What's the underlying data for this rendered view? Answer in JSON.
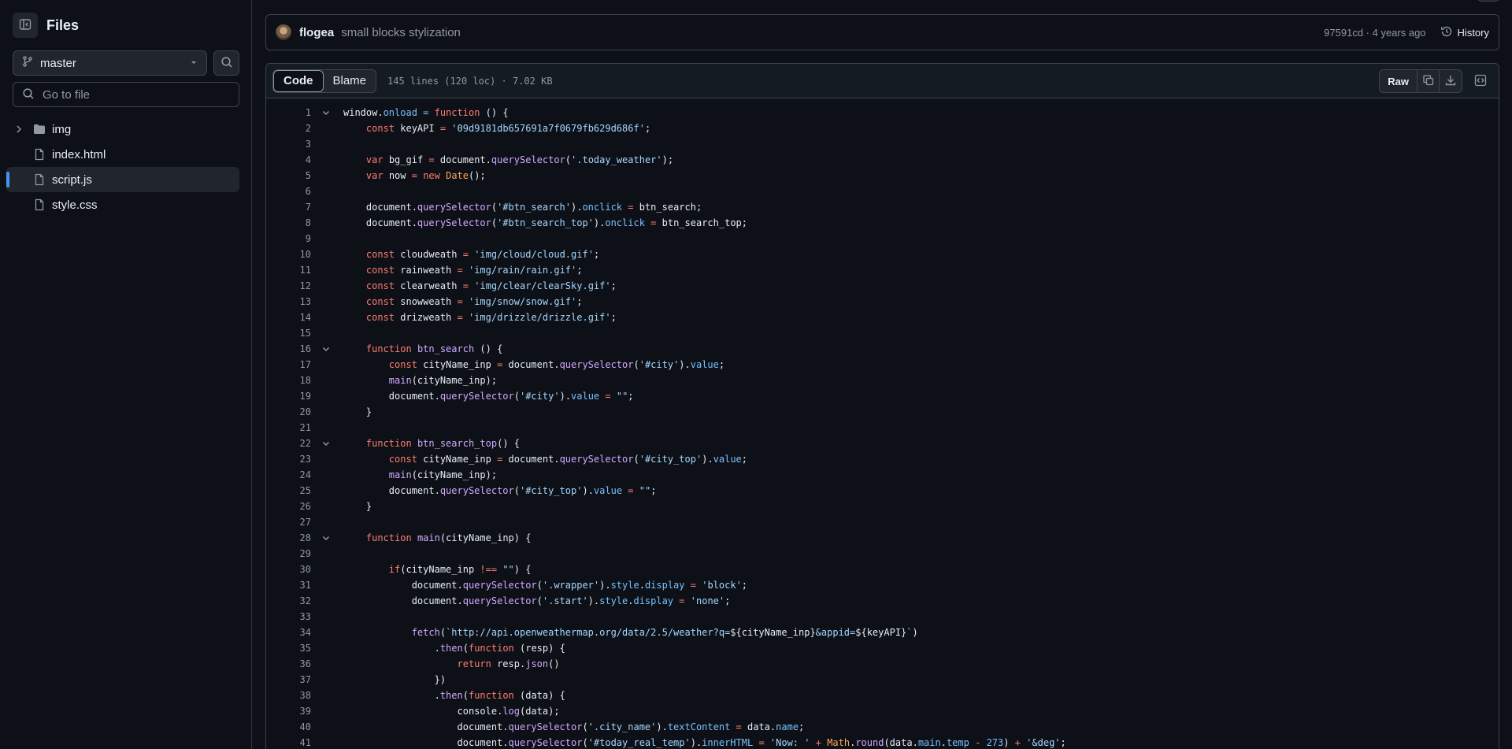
{
  "sidebar": {
    "title": "Files",
    "branch": "master",
    "goto_placeholder": "Go to file",
    "tree": [
      {
        "name": "img",
        "type": "folder",
        "active": false
      },
      {
        "name": "index.html",
        "type": "file",
        "active": false
      },
      {
        "name": "script.js",
        "type": "file",
        "active": true
      },
      {
        "name": "style.css",
        "type": "file",
        "active": false
      }
    ]
  },
  "commit": {
    "author": "flogea",
    "message": "small blocks stylization",
    "meta": "97591cd · 4 years ago",
    "history_label": "History"
  },
  "file": {
    "tabs": [
      {
        "label": "Code",
        "selected": true
      },
      {
        "label": "Blame",
        "selected": false
      }
    ],
    "info": "145 lines (120 loc) · 7.02 KB",
    "raw_label": "Raw"
  },
  "colors": {
    "keyword": "#ff7b72",
    "string": "#a5d6ff",
    "function": "#d2a8ff",
    "property": "#79c0ff",
    "builtin": "#ffa657",
    "accent": "#4493f8"
  },
  "code": [
    {
      "n": "1",
      "fold": true,
      "t": [
        [
          "",
          "window."
        ],
        [
          "p",
          "onload"
        ],
        [
          "p",
          " = "
        ],
        [
          "k",
          "function"
        ],
        [
          "",
          " () {"
        ]
      ]
    },
    {
      "n": "2",
      "t": [
        [
          "",
          "    "
        ],
        [
          "k",
          "const"
        ],
        [
          "",
          " keyAPI "
        ],
        [
          "k",
          "="
        ],
        [
          "",
          " "
        ],
        [
          "s",
          "'09d9181db657691a7f0679fb629d686f'"
        ],
        [
          "",
          ";"
        ]
      ]
    },
    {
      "n": "3",
      "t": [
        [
          "",
          ""
        ]
      ]
    },
    {
      "n": "4",
      "t": [
        [
          "",
          "    "
        ],
        [
          "k",
          "var"
        ],
        [
          "",
          " bg_gif "
        ],
        [
          "k",
          "="
        ],
        [
          "",
          " document."
        ],
        [
          "f",
          "querySelector"
        ],
        [
          "",
          "("
        ],
        [
          "s",
          "'.today_weather'"
        ],
        [
          "",
          ");"
        ]
      ]
    },
    {
      "n": "5",
      "t": [
        [
          "",
          "    "
        ],
        [
          "k",
          "var"
        ],
        [
          "",
          " now "
        ],
        [
          "k",
          "="
        ],
        [
          "",
          " "
        ],
        [
          "k",
          "new"
        ],
        [
          "",
          " "
        ],
        [
          "o",
          "Date"
        ],
        [
          "",
          "();"
        ]
      ]
    },
    {
      "n": "6",
      "t": [
        [
          "",
          ""
        ]
      ]
    },
    {
      "n": "7",
      "t": [
        [
          "",
          "    document."
        ],
        [
          "f",
          "querySelector"
        ],
        [
          "",
          "("
        ],
        [
          "s",
          "'#btn_search'"
        ],
        [
          "",
          ")."
        ],
        [
          "p",
          "onclick"
        ],
        [
          "",
          " "
        ],
        [
          "k",
          "="
        ],
        [
          "",
          " btn_search;"
        ]
      ]
    },
    {
      "n": "8",
      "t": [
        [
          "",
          "    document."
        ],
        [
          "f",
          "querySelector"
        ],
        [
          "",
          "("
        ],
        [
          "s",
          "'#btn_search_top'"
        ],
        [
          "",
          ")."
        ],
        [
          "p",
          "onclick"
        ],
        [
          "",
          " "
        ],
        [
          "k",
          "="
        ],
        [
          "",
          " btn_search_top;"
        ]
      ]
    },
    {
      "n": "9",
      "t": [
        [
          "",
          ""
        ]
      ]
    },
    {
      "n": "10",
      "t": [
        [
          "",
          "    "
        ],
        [
          "k",
          "const"
        ],
        [
          "",
          " cloudweath "
        ],
        [
          "k",
          "="
        ],
        [
          "",
          " "
        ],
        [
          "s",
          "'img/cloud/cloud.gif'"
        ],
        [
          "",
          ";"
        ]
      ]
    },
    {
      "n": "11",
      "t": [
        [
          "",
          "    "
        ],
        [
          "k",
          "const"
        ],
        [
          "",
          " rainweath "
        ],
        [
          "k",
          "="
        ],
        [
          "",
          " "
        ],
        [
          "s",
          "'img/rain/rain.gif'"
        ],
        [
          "",
          ";"
        ]
      ]
    },
    {
      "n": "12",
      "t": [
        [
          "",
          "    "
        ],
        [
          "k",
          "const"
        ],
        [
          "",
          " clearweath "
        ],
        [
          "k",
          "="
        ],
        [
          "",
          " "
        ],
        [
          "s",
          "'img/clear/clearSky.gif'"
        ],
        [
          "",
          ";"
        ]
      ]
    },
    {
      "n": "13",
      "t": [
        [
          "",
          "    "
        ],
        [
          "k",
          "const"
        ],
        [
          "",
          " snowweath "
        ],
        [
          "k",
          "="
        ],
        [
          "",
          " "
        ],
        [
          "s",
          "'img/snow/snow.gif'"
        ],
        [
          "",
          ";"
        ]
      ]
    },
    {
      "n": "14",
      "t": [
        [
          "",
          "    "
        ],
        [
          "k",
          "const"
        ],
        [
          "",
          " drizweath "
        ],
        [
          "k",
          "="
        ],
        [
          "",
          " "
        ],
        [
          "s",
          "'img/drizzle/drizzle.gif'"
        ],
        [
          "",
          ";"
        ]
      ]
    },
    {
      "n": "15",
      "t": [
        [
          "",
          ""
        ]
      ]
    },
    {
      "n": "16",
      "fold": true,
      "t": [
        [
          "",
          "    "
        ],
        [
          "k",
          "function"
        ],
        [
          "",
          " "
        ],
        [
          "f",
          "btn_search"
        ],
        [
          "",
          " () {"
        ]
      ]
    },
    {
      "n": "17",
      "t": [
        [
          "",
          "        "
        ],
        [
          "k",
          "const"
        ],
        [
          "",
          " cityName_inp "
        ],
        [
          "k",
          "="
        ],
        [
          "",
          " document."
        ],
        [
          "f",
          "querySelector"
        ],
        [
          "",
          "("
        ],
        [
          "s",
          "'#city'"
        ],
        [
          "",
          ")."
        ],
        [
          "p",
          "value"
        ],
        [
          "",
          ";"
        ]
      ]
    },
    {
      "n": "18",
      "t": [
        [
          "",
          "        "
        ],
        [
          "f",
          "main"
        ],
        [
          "",
          "(cityName_inp);"
        ]
      ]
    },
    {
      "n": "19",
      "t": [
        [
          "",
          "        document."
        ],
        [
          "f",
          "querySelector"
        ],
        [
          "",
          "("
        ],
        [
          "s",
          "'#city'"
        ],
        [
          "",
          ")."
        ],
        [
          "p",
          "value"
        ],
        [
          "",
          " "
        ],
        [
          "k",
          "="
        ],
        [
          "",
          " "
        ],
        [
          "s",
          "\"\""
        ],
        [
          "",
          ";"
        ]
      ]
    },
    {
      "n": "20",
      "t": [
        [
          "",
          "    }"
        ]
      ]
    },
    {
      "n": "21",
      "t": [
        [
          "",
          ""
        ]
      ]
    },
    {
      "n": "22",
      "fold": true,
      "t": [
        [
          "",
          "    "
        ],
        [
          "k",
          "function"
        ],
        [
          "",
          " "
        ],
        [
          "f",
          "btn_search_top"
        ],
        [
          "",
          "() {"
        ]
      ]
    },
    {
      "n": "23",
      "t": [
        [
          "",
          "        "
        ],
        [
          "k",
          "const"
        ],
        [
          "",
          " cityName_inp "
        ],
        [
          "k",
          "="
        ],
        [
          "",
          " document."
        ],
        [
          "f",
          "querySelector"
        ],
        [
          "",
          "("
        ],
        [
          "s",
          "'#city_top'"
        ],
        [
          "",
          ")."
        ],
        [
          "p",
          "value"
        ],
        [
          "",
          ";"
        ]
      ]
    },
    {
      "n": "24",
      "t": [
        [
          "",
          "        "
        ],
        [
          "f",
          "main"
        ],
        [
          "",
          "(cityName_inp);"
        ]
      ]
    },
    {
      "n": "25",
      "t": [
        [
          "",
          "        document."
        ],
        [
          "f",
          "querySelector"
        ],
        [
          "",
          "("
        ],
        [
          "s",
          "'#city_top'"
        ],
        [
          "",
          ")."
        ],
        [
          "p",
          "value"
        ],
        [
          "",
          " "
        ],
        [
          "k",
          "="
        ],
        [
          "",
          " "
        ],
        [
          "s",
          "\"\""
        ],
        [
          "",
          ";"
        ]
      ]
    },
    {
      "n": "26",
      "t": [
        [
          "",
          "    }"
        ]
      ]
    },
    {
      "n": "27",
      "t": [
        [
          "",
          ""
        ]
      ]
    },
    {
      "n": "28",
      "fold": true,
      "t": [
        [
          "",
          "    "
        ],
        [
          "k",
          "function"
        ],
        [
          "",
          " "
        ],
        [
          "f",
          "main"
        ],
        [
          "",
          "(cityName_inp) {"
        ]
      ]
    },
    {
      "n": "29",
      "t": [
        [
          "",
          ""
        ]
      ]
    },
    {
      "n": "30",
      "t": [
        [
          "",
          "        "
        ],
        [
          "k",
          "if"
        ],
        [
          "",
          "(cityName_inp "
        ],
        [
          "k",
          "!=="
        ],
        [
          "",
          " "
        ],
        [
          "s",
          "\"\""
        ],
        [
          "",
          ") {"
        ]
      ]
    },
    {
      "n": "31",
      "t": [
        [
          "",
          "            document."
        ],
        [
          "f",
          "querySelector"
        ],
        [
          "",
          "("
        ],
        [
          "s",
          "'.wrapper'"
        ],
        [
          "",
          ")."
        ],
        [
          "p",
          "style"
        ],
        [
          "",
          "."
        ],
        [
          "p",
          "display"
        ],
        [
          "",
          " "
        ],
        [
          "k",
          "="
        ],
        [
          "",
          " "
        ],
        [
          "s",
          "'block'"
        ],
        [
          "",
          ";"
        ]
      ]
    },
    {
      "n": "32",
      "t": [
        [
          "",
          "            document."
        ],
        [
          "f",
          "querySelector"
        ],
        [
          "",
          "("
        ],
        [
          "s",
          "'.start'"
        ],
        [
          "",
          ")."
        ],
        [
          "p",
          "style"
        ],
        [
          "",
          "."
        ],
        [
          "p",
          "display"
        ],
        [
          "",
          " "
        ],
        [
          "k",
          "="
        ],
        [
          "",
          " "
        ],
        [
          "s",
          "'none'"
        ],
        [
          "",
          ";"
        ]
      ]
    },
    {
      "n": "33",
      "t": [
        [
          "",
          ""
        ]
      ]
    },
    {
      "n": "34",
      "t": [
        [
          "",
          "            "
        ],
        [
          "f",
          "fetch"
        ],
        [
          "",
          "("
        ],
        [
          "s",
          "`http://api.openweathermap.org/data/2.5/weather?q="
        ],
        [
          "",
          "${cityName_inp}"
        ],
        [
          "s",
          "&appid="
        ],
        [
          "",
          "${keyAPI}"
        ],
        [
          "s",
          "`"
        ],
        [
          "",
          ")"
        ]
      ]
    },
    {
      "n": "35",
      "t": [
        [
          "",
          "                ."
        ],
        [
          "f",
          "then"
        ],
        [
          "",
          "("
        ],
        [
          "k",
          "function"
        ],
        [
          "",
          " (resp) {"
        ]
      ]
    },
    {
      "n": "36",
      "t": [
        [
          "",
          "                    "
        ],
        [
          "k",
          "return"
        ],
        [
          "",
          " resp."
        ],
        [
          "f",
          "json"
        ],
        [
          "",
          "()"
        ]
      ]
    },
    {
      "n": "37",
      "t": [
        [
          "",
          "                })"
        ]
      ]
    },
    {
      "n": "38",
      "t": [
        [
          "",
          "                ."
        ],
        [
          "f",
          "then"
        ],
        [
          "",
          "("
        ],
        [
          "k",
          "function"
        ],
        [
          "",
          " (data) {"
        ]
      ]
    },
    {
      "n": "39",
      "t": [
        [
          "",
          "                    console."
        ],
        [
          "f",
          "log"
        ],
        [
          "",
          "(data);"
        ]
      ]
    },
    {
      "n": "40",
      "t": [
        [
          "",
          "                    document."
        ],
        [
          "f",
          "querySelector"
        ],
        [
          "",
          "("
        ],
        [
          "s",
          "'.city_name'"
        ],
        [
          "",
          ")."
        ],
        [
          "p",
          "textContent"
        ],
        [
          "",
          " "
        ],
        [
          "k",
          "="
        ],
        [
          "",
          " data."
        ],
        [
          "p",
          "name"
        ],
        [
          "",
          ";"
        ]
      ]
    },
    {
      "n": "41",
      "t": [
        [
          "",
          "                    document."
        ],
        [
          "f",
          "querySelector"
        ],
        [
          "",
          "("
        ],
        [
          "s",
          "'#today_real_temp'"
        ],
        [
          "",
          ")."
        ],
        [
          "p",
          "innerHTML"
        ],
        [
          "",
          " "
        ],
        [
          "k",
          "="
        ],
        [
          "",
          " "
        ],
        [
          "s",
          "'Now: '"
        ],
        [
          "",
          " "
        ],
        [
          "k",
          "+"
        ],
        [
          "",
          " "
        ],
        [
          "o",
          "Math"
        ],
        [
          "",
          "."
        ],
        [
          "f",
          "round"
        ],
        [
          "",
          "(data."
        ],
        [
          "p",
          "main"
        ],
        [
          "",
          "."
        ],
        [
          "p",
          "temp"
        ],
        [
          "",
          " "
        ],
        [
          "k",
          "-"
        ],
        [
          "",
          " "
        ],
        [
          "p",
          "273"
        ],
        [
          "",
          ") "
        ],
        [
          "k",
          "+"
        ],
        [
          "",
          " "
        ],
        [
          "s",
          "'&deg'"
        ],
        [
          "",
          ";"
        ]
      ]
    }
  ]
}
